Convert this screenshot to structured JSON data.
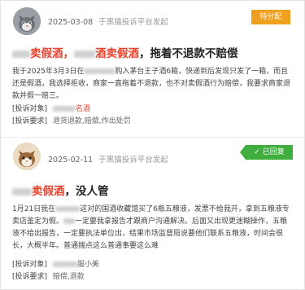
{
  "complaints": [
    {
      "date": "2025-03-08",
      "source": "于黑猫投诉平台发起",
      "status": "待分配",
      "title_part1": "卖假酒，",
      "title_part2": "酒卖假酒",
      "title_part3": "，拖着不退款不赔偿",
      "body_a": "我于2025年3月3日在",
      "body_b": "购入茅台王子酒6箱，快递到后发现只发了一箱，而且还是假酒，我选择拒收，商家一直拖着不退款，也不对卖假酒行为赔偿，我要求商家退款并假一赔三。",
      "object_label": "[投诉对象]",
      "object_value_suffix": "名酒",
      "request_label": "[投诉要求]",
      "request_value": "退货退款,赔偿,作出处罚"
    },
    {
      "date": "2025-02-11",
      "source": "于黑猫投诉平台发起",
      "status": "已回复",
      "title_part1": "卖假酒",
      "title_part2": "，没人管",
      "body_a": "1月21日我在",
      "body_b": "这对的国酒收藏馆买了6瓶五粮液，发票不给我开，拿到五粮液专卖店鉴定为假。",
      "body_c": "一定要我拿报告才跟商户沟通解决。后面又出现更迷糊操作，五粮液不给出报告，一定要执法单位出，结果市场监督局说要他们联系五粮液，时间会很长，大概半年。普通揣点这么普通事要这么难",
      "object_label": "[投诉对象]",
      "object_value_suffix": "服小美",
      "request_label": "[投诉要求]",
      "request_value": "赔偿,退款"
    }
  ],
  "icons": {
    "check": "check-icon",
    "avatar1": "grey-cat-avatar",
    "avatar2": "tan-cat-avatar"
  },
  "colors": {
    "pending": "#f0a020",
    "replied": "#3fae3f",
    "highlight": "#e5412d"
  }
}
